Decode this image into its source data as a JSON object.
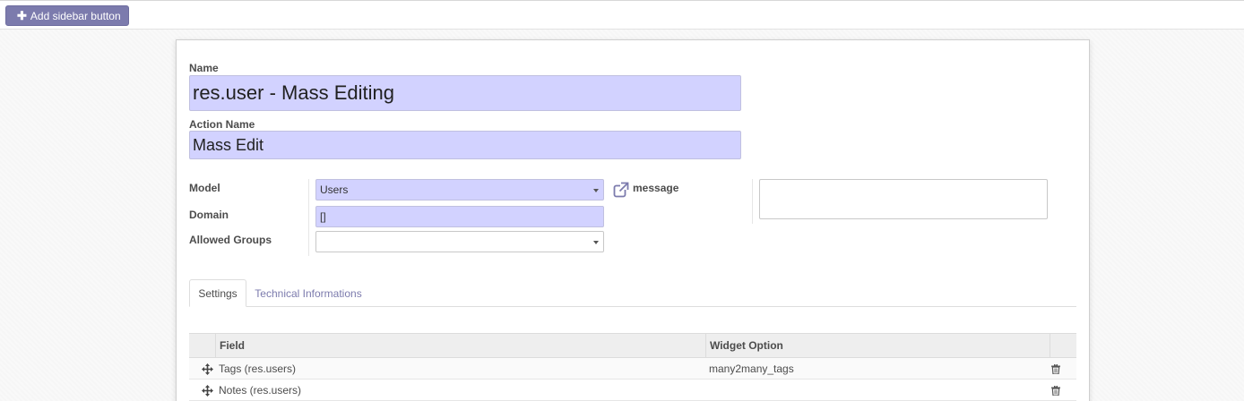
{
  "topbar": {
    "add_sidebar_button": "Add sidebar button"
  },
  "form": {
    "name_label": "Name",
    "name_value": "res.user - Mass Editing",
    "action_name_label": "Action Name",
    "action_name_value": "Mass Edit",
    "model_label": "Model",
    "model_value": "Users",
    "domain_label": "Domain",
    "domain_value": "[]",
    "allowed_groups_label": "Allowed Groups",
    "allowed_groups_value": "",
    "message_label": "message",
    "message_value": ""
  },
  "tabs": [
    {
      "label": "Settings",
      "active": true
    },
    {
      "label": "Technical Informations",
      "active": false
    }
  ],
  "table": {
    "columns": [
      "Field",
      "Widget Option"
    ],
    "rows": [
      {
        "field": "Tags (res.users)",
        "widget_option": "many2many_tags"
      },
      {
        "field": "Notes (res.users)",
        "widget_option": ""
      }
    ]
  },
  "colors": {
    "accent": "#7c7bad",
    "required_field": "#d2d2ff"
  },
  "icons": {
    "add": "plus-icon",
    "external_link": "external-link-icon",
    "drag": "move-arrows-icon",
    "delete": "trash-icon",
    "dropdown": "caret-down-icon"
  }
}
